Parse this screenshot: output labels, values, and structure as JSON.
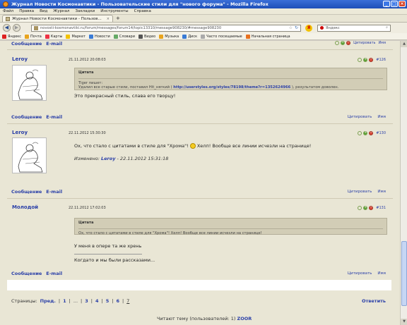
{
  "window": {
    "title": "Журнал Новости Космонавтики - Пользовательские стили для \"нового форума\" - Mozilla Firefox",
    "buttons": [
      "_",
      "□",
      "×"
    ]
  },
  "menu": [
    "Файл",
    "Правка",
    "Вид",
    "Журнал",
    "Закладки",
    "Инструменты",
    "Справка"
  ],
  "tab": {
    "label": "Журнал Новости Космонавтики - Пользов...",
    "close": "×",
    "new": "+"
  },
  "nav": {
    "url": "novosti-kosmonavtiki.ru/forum/messages/forum14/topic13310/message908230/#message908230",
    "search_value": "Яндекс"
  },
  "bookmarks": [
    {
      "label": "Яндекс",
      "color": "#d22"
    },
    {
      "label": "Почта",
      "color": "#e8a41e"
    },
    {
      "label": "Карты",
      "color": "#e34"
    },
    {
      "label": "Маркет",
      "color": "#f2c200"
    },
    {
      "label": "Новости",
      "color": "#3a7bd5"
    },
    {
      "label": "Словари",
      "color": "#6a6"
    },
    {
      "label": "Видео",
      "color": "#555"
    },
    {
      "label": "Музыка",
      "color": "#e8a41e"
    },
    {
      "label": "Диск",
      "color": "#3a7bd5"
    },
    {
      "label": "Часто посещаемые",
      "color": "#aaa"
    },
    {
      "label": "Начальная страница",
      "color": "#e8711e"
    }
  ],
  "labels": {
    "message": "Сообщение",
    "email": "E-mail",
    "quote_action": "Цитировать",
    "name_action": "Имя",
    "quote_title": "Цитата",
    "edited_prefix": "Изменено:"
  },
  "posts": [
    {
      "author": "Leroy",
      "date": "21.11.2012 20:08:03",
      "number": "#126",
      "quote_author": "Tiger пишет:",
      "quote_text": "Удалил все старые стили, поставил Hit_нягкий (",
      "quote_link": "http://userstyles.org/styles/78198/theme?r=1352624966",
      "quote_after": "), результатом доволен.",
      "text": "Это прекрасный стиль, слава его творцу!"
    },
    {
      "author": "Leroy",
      "date": "22.11.2012 15:30:30",
      "number": "#130",
      "text_before": "Ох, что стало с цитатами в стиле для \"Хрома\"!",
      "text_after": "Хелп! Вообще все линии исчезли на странице!",
      "edited_author": "Leroy",
      "edited_date": "- 22.11.2012 15:31:18"
    },
    {
      "author": "Молодой",
      "date": "22.11.2012 17:02:03",
      "number": "#131",
      "quote_text": "Ох, что стало с цитатами в стиле для \"Хрома\"! Хелп! Вообще все линии исчезли на странице!",
      "text": "У меня в опере та же хрень",
      "signature": "Когдато и мы были рассказами..."
    }
  ],
  "pager": {
    "label": "Страницы:",
    "prev": "Пред.",
    "pages": [
      "1",
      "...",
      "3",
      "4",
      "5",
      "6",
      "7"
    ],
    "sep": "|"
  },
  "reply": "Ответить",
  "readers": {
    "prefix": "Читают тему (пользователей: 1)",
    "user": "ZOOR"
  }
}
